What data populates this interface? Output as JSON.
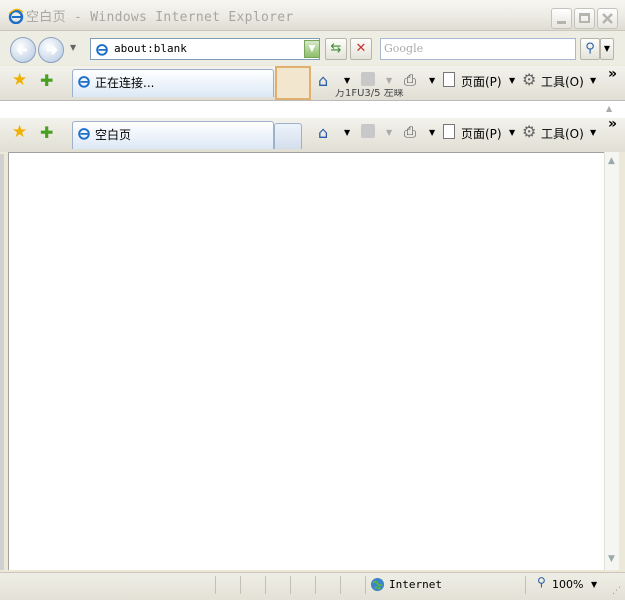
{
  "window": {
    "title": "空白页 - Windows Internet Explorer"
  },
  "address_bar": {
    "value": "about:blank"
  },
  "search": {
    "placeholder": "Google"
  },
  "background_tab_row": {
    "tab_label": "正在连接...",
    "page_label": "页面(P)",
    "tools_label": "工具(O)",
    "partial_text": "万1FU3/5 左睐"
  },
  "tab_row": {
    "tab_label": "空白页",
    "page_label": "页面(P)",
    "tools_label": "工具(O)"
  },
  "status_bar": {
    "zone": "Internet",
    "zoom": "100%"
  },
  "colors": {
    "titlebar_bg": "#ecebe4",
    "content_bg": "#ffffff",
    "status_bg": "#e9e7dc"
  }
}
